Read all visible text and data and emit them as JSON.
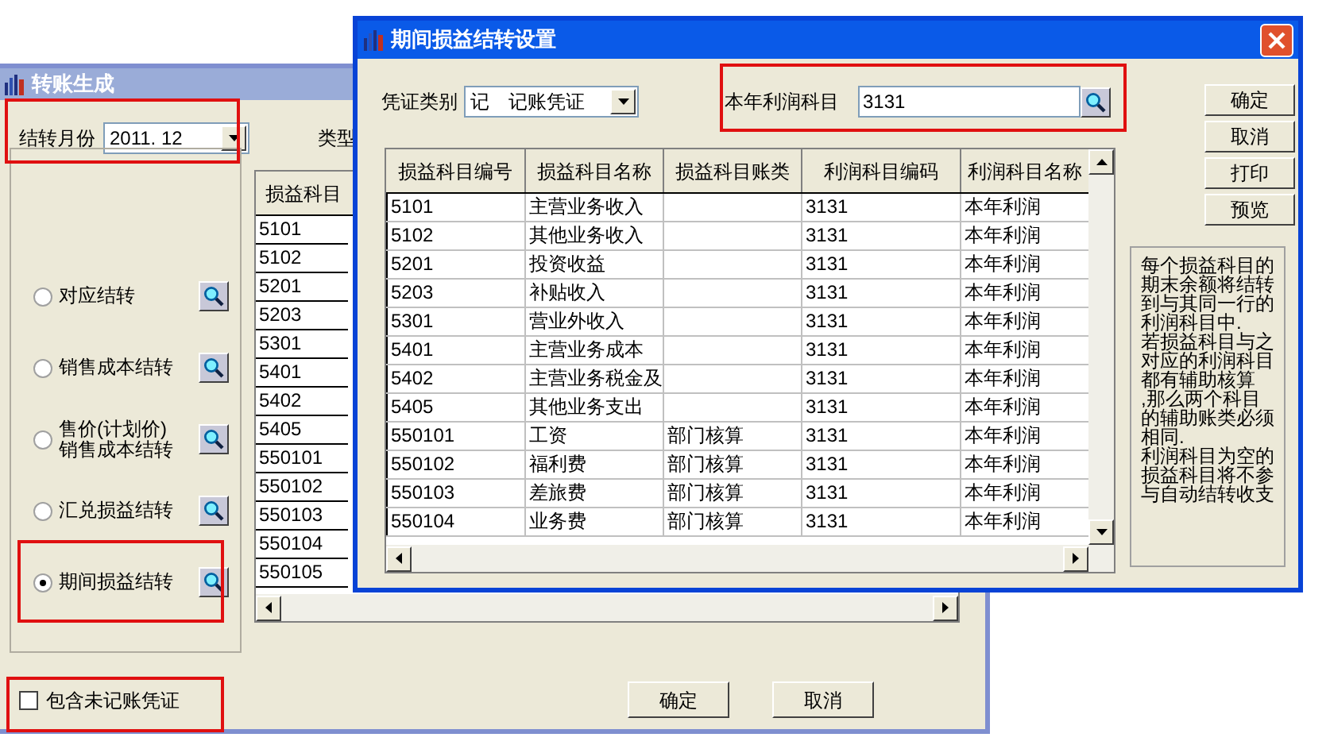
{
  "main_window": {
    "title": "转账生成",
    "month_label": "结转月份",
    "month_value": "2011. 12",
    "type_label": "类型",
    "options": [
      {
        "label": "对应结转",
        "selected": false
      },
      {
        "label": "销售成本结转",
        "selected": false
      },
      {
        "label": "售价(计划价)\n销售成本结转",
        "selected": false
      },
      {
        "label": "汇兑损益结转",
        "selected": false
      },
      {
        "label": "期间损益结转",
        "selected": true
      }
    ],
    "table": {
      "column_1": "损益科目",
      "rows": [
        "5101",
        "5102",
        "5201",
        "5203",
        "5301",
        "5401",
        "5402",
        "5405",
        "550101",
        "550102",
        "550103",
        "550104",
        "550105"
      ]
    },
    "include_unposted": {
      "label": "包含未记账凭证",
      "checked": false
    },
    "buttons": [
      "确定",
      "取消"
    ]
  },
  "dialog": {
    "title": "期间损益结转设置",
    "voucher_type": {
      "label": "凭证类别",
      "value": "记　记账凭证"
    },
    "profit_account": {
      "label": "本年利润科目",
      "value": "3131"
    },
    "table": {
      "columns": [
        "损益科目编号",
        "损益科目名称",
        "损益科目账类",
        "利润科目编码",
        "利润科目名称"
      ],
      "rows": [
        [
          "5101",
          "主营业务收入",
          "",
          "3131",
          "本年利润"
        ],
        [
          "5102",
          "其他业务收入",
          "",
          "3131",
          "本年利润"
        ],
        [
          "5201",
          "投资收益",
          "",
          "3131",
          "本年利润"
        ],
        [
          "5203",
          "补贴收入",
          "",
          "3131",
          "本年利润"
        ],
        [
          "5301",
          "营业外收入",
          "",
          "3131",
          "本年利润"
        ],
        [
          "5401",
          "主营业务成本",
          "",
          "3131",
          "本年利润"
        ],
        [
          "5402",
          "主营业务税金及",
          "",
          "3131",
          "本年利润"
        ],
        [
          "5405",
          "其他业务支出",
          "",
          "3131",
          "本年利润"
        ],
        [
          "550101",
          "工资",
          "部门核算",
          "3131",
          "本年利润"
        ],
        [
          "550102",
          "福利费",
          "部门核算",
          "3131",
          "本年利润"
        ],
        [
          "550103",
          "差旅费",
          "部门核算",
          "3131",
          "本年利润"
        ],
        [
          "550104",
          "业务费",
          "部门核算",
          "3131",
          "本年利润"
        ]
      ]
    },
    "buttons": [
      "确定",
      "取消",
      "打印",
      "预览"
    ],
    "note": [
      "每个损益科目的期末余额将结转到与其同一行的利润科目中.",
      "若损益科目与之对应的利润科目都有辅助核算",
      ",那么两个科目的辅助账类必须相同.",
      "利润科目为空的损益科目将不参与自动结转收支"
    ]
  }
}
